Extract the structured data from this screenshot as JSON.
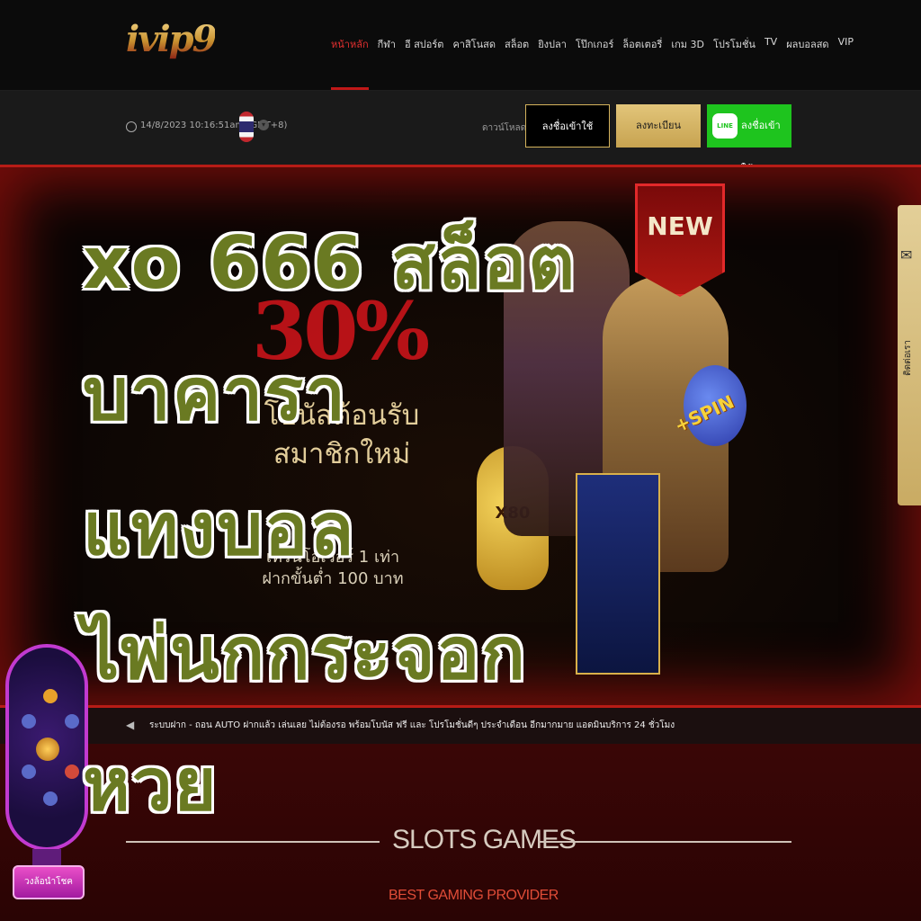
{
  "header": {
    "logo": "ivip9",
    "menu": [
      {
        "label": "หน้าหลัก",
        "active": true
      },
      {
        "label": "กีฬา"
      },
      {
        "label": "อี สปอร์ต"
      },
      {
        "label": "คาสิโนสด"
      },
      {
        "label": "สล็อต"
      },
      {
        "label": "ยิงปลา"
      },
      {
        "label": "โป๊กเกอร์"
      },
      {
        "label": "ล็อตเตอรี่"
      },
      {
        "label": "เกม 3D"
      },
      {
        "label": "โปรโมชั่น"
      },
      {
        "label": "TV"
      },
      {
        "label": "ผลบอลสด"
      },
      {
        "label": "VIP"
      }
    ]
  },
  "subbar": {
    "datetime": "14/8/2023 10:16:51am (GMT+8)",
    "flag_icon": "thailand-flag",
    "download_label": "ดาวน์โหลด",
    "login_label": "ลงชื่อเข้าใช้",
    "register_label": "ลงทะเบียน",
    "line_icon_text": "LINE",
    "line_login_label": "ลงชื่อเข้าใช้"
  },
  "banner": {
    "badge": "NEW",
    "percent": "30%",
    "bonus_text": "โบนัสต้อนรับ สมาชิกใหม่",
    "turnover_text": "เทิร์นโอเวอร์ 1 เท่า ฝากขั้นต่ำ 100 บาท",
    "multiplier": "X80",
    "spin": "+SPIN"
  },
  "contact_tab": {
    "label": "ติดต่อเรา",
    "icon": "mail-icon"
  },
  "ticker": {
    "icon": "speaker-icon",
    "text": "ระบบฝาก - ถอน AUTO  ฝากแล้ว เล่นเลย ไม่ต้องรอ พร้อมโบนัส ฟรี และ โปรโมชั่นดีๆ ประจำเดือน อีกมากมาย แอดมินบริการ 24 ชั่วโมง"
  },
  "slots_section": {
    "title": "SLOTS GAMES",
    "subtitle": "BEST GAMING PROVIDER"
  },
  "lucky_wheel": {
    "button_label": "วงล้อนำโชค"
  },
  "overlay": {
    "lines": [
      "xo 666 สล็อต",
      "บาคารา",
      "แทงบอล",
      "ไพ่นกกระจอก",
      "หวย"
    ]
  },
  "colors": {
    "accent_red": "#c01818",
    "gold": "#d4b35c",
    "line_green": "#1ec41e",
    "overlay_text": "#6a7a22"
  }
}
